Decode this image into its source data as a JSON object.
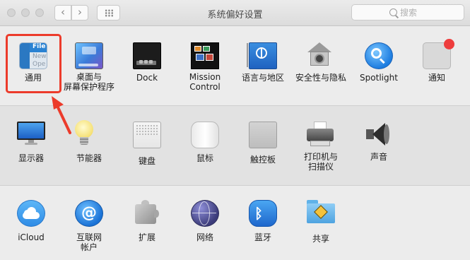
{
  "window": {
    "title": "系统偏好设置",
    "nav": {
      "back_glyph": "‹",
      "forward_glyph": "›"
    }
  },
  "search": {
    "placeholder": "搜索",
    "value": ""
  },
  "accent_colors": {
    "highlight": "#ec3b2b",
    "notification_dot": "#ee3d3d"
  },
  "sections": {
    "personal": [
      {
        "id": "general",
        "label": "通用",
        "icon": "general-icon",
        "mini_text": [
          "File",
          "New",
          "Ope"
        ]
      },
      {
        "id": "desktop-screensaver",
        "label_line1": "桌面与",
        "label_line2": "屏幕保护程序",
        "icon": "desktop-screensaver-icon"
      },
      {
        "id": "dock",
        "label": "Dock",
        "icon": "dock-icon"
      },
      {
        "id": "mission-control",
        "label_line1": "Mission",
        "label_line2": "Control",
        "icon": "mission-control-icon"
      },
      {
        "id": "language-region",
        "label": "语言与地区",
        "icon": "language-region-icon"
      },
      {
        "id": "security-privacy",
        "label": "安全性与隐私",
        "icon": "security-privacy-icon"
      },
      {
        "id": "spotlight",
        "label": "Spotlight",
        "icon": "spotlight-icon"
      },
      {
        "id": "notifications",
        "label": "通知",
        "icon": "notifications-icon"
      }
    ],
    "hardware": [
      {
        "id": "displays",
        "label": "显示器",
        "icon": "displays-icon"
      },
      {
        "id": "energy-saver",
        "label": "节能器",
        "icon": "energy-saver-icon"
      },
      {
        "id": "keyboard",
        "label": "键盘",
        "icon": "keyboard-icon"
      },
      {
        "id": "mouse",
        "label": "鼠标",
        "icon": "mouse-icon"
      },
      {
        "id": "trackpad",
        "label": "触控板",
        "icon": "trackpad-icon"
      },
      {
        "id": "printers-scanners",
        "label_line1": "打印机与",
        "label_line2": "扫描仪",
        "icon": "printer-icon"
      },
      {
        "id": "sound",
        "label": "声音",
        "icon": "sound-icon"
      }
    ],
    "internet": [
      {
        "id": "icloud",
        "label": "iCloud",
        "icon": "icloud-icon"
      },
      {
        "id": "internet-accounts",
        "label_line1": "互联网",
        "label_line2": "帐户",
        "icon": "internet-accounts-icon",
        "glyph": "@"
      },
      {
        "id": "extensions",
        "label": "扩展",
        "icon": "extensions-icon"
      },
      {
        "id": "network",
        "label": "网络",
        "icon": "network-icon"
      },
      {
        "id": "bluetooth",
        "label": "蓝牙",
        "icon": "bluetooth-icon",
        "glyph": "ᛒ"
      },
      {
        "id": "sharing",
        "label": "共享",
        "icon": "sharing-icon"
      }
    ]
  }
}
